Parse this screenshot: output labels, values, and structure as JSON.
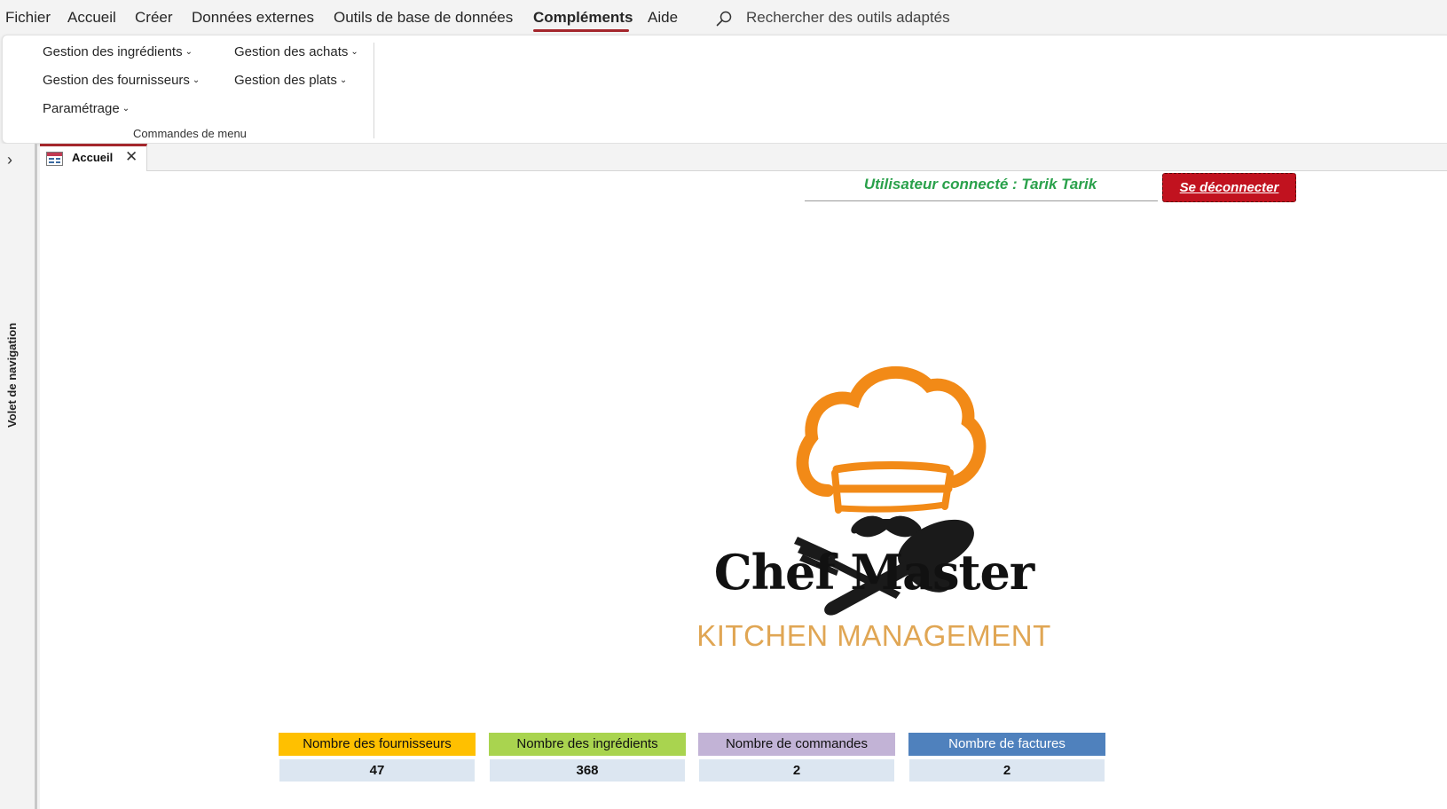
{
  "menubar": {
    "items": [
      "Fichier",
      "Accueil",
      "Créer",
      "Données externes",
      "Outils de base de données",
      "Compléments",
      "Aide"
    ],
    "active": "Compléments",
    "search_placeholder": "Rechercher des outils adaptés"
  },
  "ribbon": {
    "buttons": {
      "ingredients": "Gestion des ingrédients",
      "achats": "Gestion des achats",
      "fournisseurs": "Gestion des fournisseurs",
      "plats": "Gestion des plats",
      "parametrage": "Paramétrage"
    },
    "group_label": "Commandes de menu"
  },
  "navpane": {
    "label": "Volet de navigation"
  },
  "tab": {
    "label": "Accueil"
  },
  "form": {
    "user_text": "Utilisateur connecté : Tarik Tarik",
    "logout_label": "Se déconnecter",
    "brand": "Chef Master",
    "tagline": "KITCHEN MANAGEMENT",
    "stats": [
      {
        "label": "Nombre des fournisseurs",
        "value": "47",
        "color": "#ffc000"
      },
      {
        "label": "Nombre des ingrédients",
        "value": "368",
        "color": "#a9d44f"
      },
      {
        "label": "Nombre de commandes",
        "value": "2",
        "color": "#c2b3d6"
      },
      {
        "label": "Nombre de factures",
        "value": "2",
        "color": "#4f81bd"
      }
    ]
  },
  "colors": {
    "accent": "#a4262c",
    "user_text": "#2aa14b",
    "logout_bg": "#c1121f",
    "logo_orange": "#f28a17"
  }
}
